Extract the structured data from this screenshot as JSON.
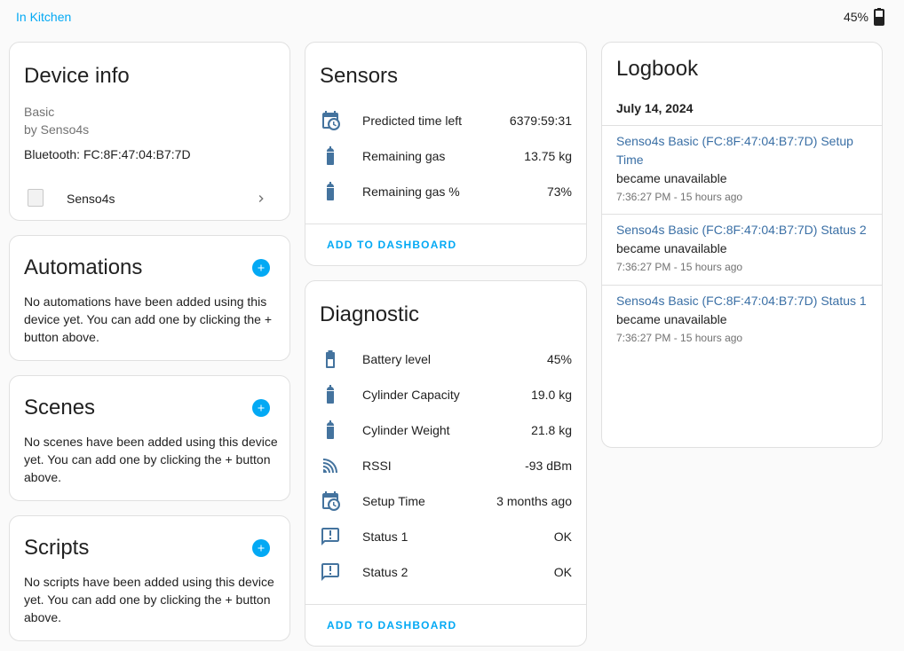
{
  "header": {
    "area_link": "In Kitchen",
    "battery": "45%"
  },
  "device_info": {
    "title": "Device info",
    "model": "Basic",
    "manufacturer": "by Senso4s",
    "connection": "Bluetooth: FC:8F:47:04:B7:7D",
    "integration_label": "Senso4s"
  },
  "automations": {
    "title": "Automations",
    "text": "No automations have been added using this device yet. You can add one by clicking the + button above."
  },
  "scenes": {
    "title": "Scenes",
    "text": "No scenes have been added using this device yet. You can add one by clicking the + button above."
  },
  "scripts": {
    "title": "Scripts",
    "text": "No scripts have been added using this device yet. You can add one by clicking the + button above."
  },
  "sensors": {
    "title": "Sensors",
    "rows": [
      {
        "icon": "calendar-clock-icon",
        "label": "Predicted time left",
        "value": "6379:59:31"
      },
      {
        "icon": "gas-cylinder-icon",
        "label": "Remaining gas",
        "value": "13.75 kg"
      },
      {
        "icon": "gas-cylinder-icon",
        "label": "Remaining gas %",
        "value": "73%"
      }
    ],
    "add_label": "ADD TO DASHBOARD"
  },
  "diagnostic": {
    "title": "Diagnostic",
    "rows": [
      {
        "icon": "battery-icon",
        "label": "Battery level",
        "value": "45%"
      },
      {
        "icon": "gas-cylinder-icon",
        "label": "Cylinder Capacity",
        "value": "19.0 kg"
      },
      {
        "icon": "gas-cylinder-icon",
        "label": "Cylinder Weight",
        "value": "21.8 kg"
      },
      {
        "icon": "wifi-signal-icon",
        "label": "RSSI",
        "value": "-93 dBm"
      },
      {
        "icon": "calendar-clock-icon",
        "label": "Setup Time",
        "value": "3 months ago"
      },
      {
        "icon": "message-alert-icon",
        "label": "Status 1",
        "value": "OK"
      },
      {
        "icon": "message-alert-icon",
        "label": "Status 2",
        "value": "OK"
      }
    ],
    "add_label": "ADD TO DASHBOARD"
  },
  "logbook": {
    "title": "Logbook",
    "date": "July 14, 2024",
    "entries": [
      {
        "entity": "Senso4s Basic (FC:8F:47:04:B7:7D) Setup Time",
        "message": "became unavailable",
        "time": "7:36:27 PM - 15 hours ago"
      },
      {
        "entity": "Senso4s Basic (FC:8F:47:04:B7:7D) Status 2",
        "message": "became unavailable",
        "time": "7:36:27 PM - 15 hours ago"
      },
      {
        "entity": "Senso4s Basic (FC:8F:47:04:B7:7D) Status 1",
        "message": "became unavailable",
        "time": "7:36:27 PM - 15 hours ago"
      }
    ]
  },
  "colors": {
    "accent": "#03a9f4",
    "icon": "#44739e",
    "link": "#3a6fa5"
  }
}
